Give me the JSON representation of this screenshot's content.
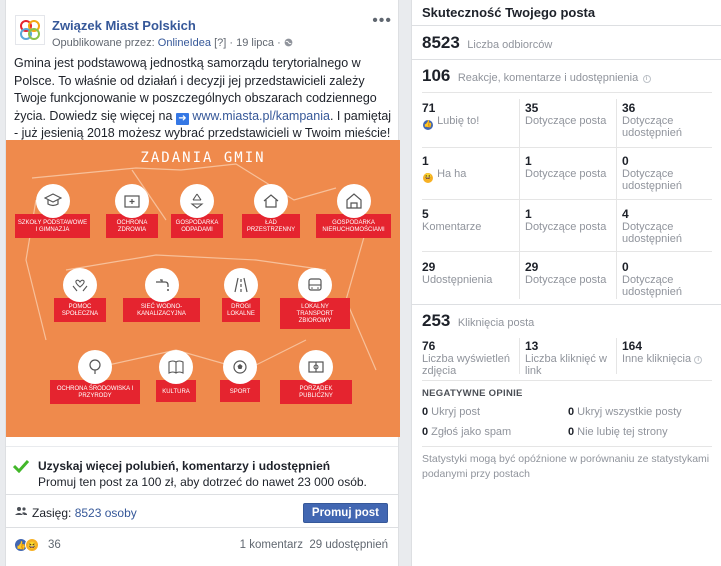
{
  "post": {
    "page_name": "Związek Miast Polskich",
    "meta_prefix": "Opublikowane przez:",
    "publisher": "OnlineIdea",
    "meta_help": "[?]",
    "meta_dot": "·",
    "date": "19 lipca",
    "text_line1": "Gmina jest podstawową jednostką samorządu terytorialnego w Polsce. To właśnie od działań i decyzji jej przedstawicieli zależy Twoje funkcjonowanie w poszczególnych obszarach codziennego życia. Dowiedz się więcej na",
    "link": "www.miasta.pl/kampania",
    "text_line2": ". I pamiętaj - już jesienią 2018 możesz wybrać przedstawicieli w Twoim mieście!",
    "infographic_title": "ZADANIA GMIN",
    "infographic_items": [
      "SZKOŁY PODSTAWOWE I GIMNAZJA",
      "OCHRONA ZDROWIA",
      "GOSPODARKA ODPADAMI",
      "ŁAD PRZESTRZENNY",
      "GOSPODARKA NIERUCHOMOŚCIAMI",
      "POMOC SPOŁECZNA",
      "SIEĆ WODNO-KANALIZACYJNA",
      "DROGI LOKALNE",
      "LOKALNY TRANSPORT ZBIOROWY",
      "OCHRONA ŚRODOWISKA I PRZYRODY",
      "KULTURA",
      "SPORT",
      "PORZĄDEK PUBLICZNY"
    ],
    "promo_title": "Uzyskaj więcej polubień, komentarzy i udostępnień",
    "promo_sub": "Promuj ten post za 100 zł, aby dotrzeć do nawet 23 000 osób.",
    "reach_label": "Zasięg:",
    "reach_value": "8523 osoby",
    "promote_button": "Promuj post",
    "reactions_count": "36",
    "comments": "1 komentarz",
    "shares": "29 udostępnień"
  },
  "insights": {
    "title": "Skuteczność Twojego posta",
    "reach_num": "8523",
    "reach_lbl": "Liczba odbiorców",
    "eng_num": "106",
    "eng_lbl": "Reakcje, komentarze i udostępnienia",
    "grid": [
      {
        "a_num": "71",
        "a_lbl": "Lubię to!",
        "b_num": "35",
        "b_lbl": "Dotyczące posta",
        "c_num": "36",
        "c_lbl": "Dotyczące udostępnień"
      },
      {
        "a_num": "1",
        "a_lbl": "Ha ha",
        "b_num": "1",
        "b_lbl": "Dotyczące posta",
        "c_num": "0",
        "c_lbl": "Dotyczące udostępnień"
      },
      {
        "a_num": "5",
        "a_lbl": "Komentarze",
        "b_num": "1",
        "b_lbl": "Dotyczące posta",
        "c_num": "4",
        "c_lbl": "Dotyczące udostępnień"
      },
      {
        "a_num": "29",
        "a_lbl": "Udostępnienia",
        "b_num": "29",
        "b_lbl": "Dotyczące posta",
        "c_num": "0",
        "c_lbl": "Dotyczące udostępnień"
      }
    ],
    "clicks_num": "253",
    "clicks_lbl": "Kliknięcia posta",
    "clicks": [
      {
        "num": "76",
        "lbl": "Liczba wyświetleń zdjęcia"
      },
      {
        "num": "13",
        "lbl": "Liczba kliknięć w link"
      },
      {
        "num": "164",
        "lbl": "Inne kliknięcia"
      }
    ],
    "neg_title": "NEGATYWNE OPINIE",
    "neg": [
      {
        "num": "0",
        "lbl": "Ukryj post"
      },
      {
        "num": "0",
        "lbl": "Ukryj wszystkie posty"
      },
      {
        "num": "0",
        "lbl": "Zgłoś jako spam"
      },
      {
        "num": "0",
        "lbl": "Nie lubię tej strony"
      }
    ],
    "note": "Statystyki mogą być opóźnione w porównaniu ze statystykami podanymi przy postach"
  },
  "colors": {
    "accent": "#4267b2",
    "link": "#365899",
    "infographic_bg": "#ef8a4c",
    "label_red": "#e5242f"
  }
}
